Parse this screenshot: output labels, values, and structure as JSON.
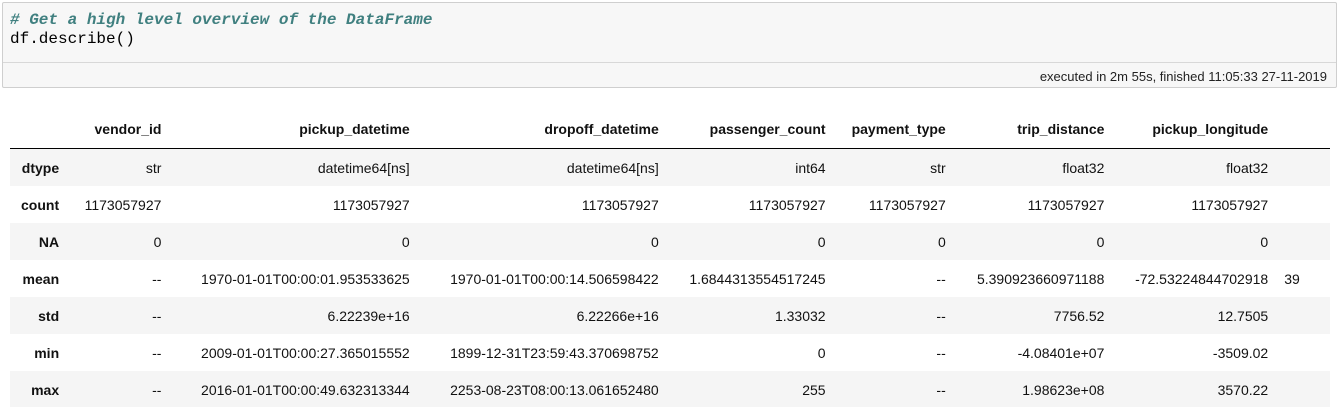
{
  "cell": {
    "comment": "# Get a high level overview of the DataFrame",
    "code": "df.describe()",
    "exec_info": "executed in 2m 55s, finished 11:05:33 27-11-2019"
  },
  "table": {
    "columns": [
      "vendor_id",
      "pickup_datetime",
      "dropoff_datetime",
      "passenger_count",
      "payment_type",
      "trip_distance",
      "pickup_longitude",
      ""
    ],
    "rows": [
      {
        "label": "dtype",
        "values": [
          "str",
          "datetime64[ns]",
          "datetime64[ns]",
          "int64",
          "str",
          "float32",
          "float32",
          ""
        ]
      },
      {
        "label": "count",
        "values": [
          "1173057927",
          "1173057927",
          "1173057927",
          "1173057927",
          "1173057927",
          "1173057927",
          "1173057927",
          ""
        ]
      },
      {
        "label": "NA",
        "values": [
          "0",
          "0",
          "0",
          "0",
          "0",
          "0",
          "0",
          ""
        ]
      },
      {
        "label": "mean",
        "values": [
          "--",
          "1970-01-01T00:00:01.953533625",
          "1970-01-01T00:00:14.506598422",
          "1.6844313554517245",
          "--",
          "5.390923660971188",
          "-72.53224844702918",
          "39"
        ]
      },
      {
        "label": "std",
        "values": [
          "--",
          "6.22239e+16",
          "6.22266e+16",
          "1.33032",
          "--",
          "7756.52",
          "12.7505",
          ""
        ]
      },
      {
        "label": "min",
        "values": [
          "--",
          "2009-01-01T00:00:27.365015552",
          "1899-12-31T23:59:43.370698752",
          "0",
          "--",
          "-4.08401e+07",
          "-3509.02",
          ""
        ]
      },
      {
        "label": "max",
        "values": [
          "--",
          "2016-01-01T00:00:49.632313344",
          "2253-08-23T08:00:13.061652480",
          "255",
          "--",
          "1.98623e+08",
          "3570.22",
          ""
        ]
      }
    ]
  }
}
